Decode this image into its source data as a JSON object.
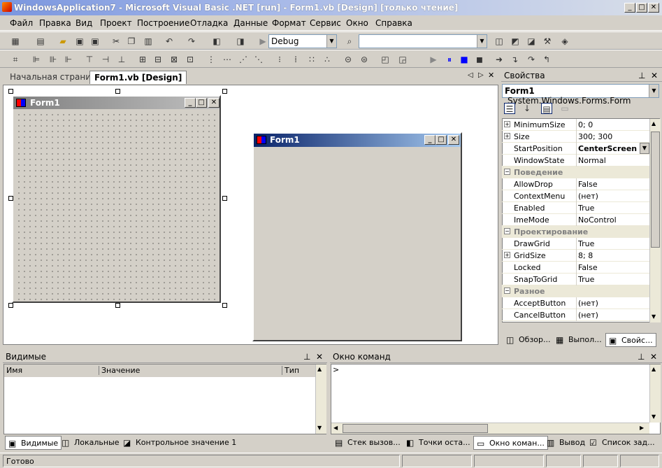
{
  "window": {
    "title": "WindowsApplication7 - Microsoft Visual Basic .NET [run] - Form1.vb [Design] [только чтение]"
  },
  "menu": [
    "Файл",
    "Правка",
    "Вид",
    "Проект",
    "Построение",
    "Отладка",
    "Данные",
    "Формат",
    "Сервис",
    "Окно",
    "Справка"
  ],
  "toolbar": {
    "config": "Debug",
    "platform": ""
  },
  "doc_tabs": [
    {
      "label": "Начальная страница"
    },
    {
      "label": "Form1.vb [Design]"
    }
  ],
  "design_form": {
    "caption": "Form1"
  },
  "run_form": {
    "caption": "Form1"
  },
  "properties": {
    "title": "Свойства",
    "object_name": "Form1",
    "object_type": "System.Windows.Forms.Form",
    "rows": [
      {
        "name": "MinimumSize",
        "value": "0; 0",
        "expand": true
      },
      {
        "name": "Size",
        "value": "300; 300",
        "expand": true
      },
      {
        "name": "StartPosition",
        "value": "CenterScreen",
        "selected": true
      },
      {
        "name": "WindowState",
        "value": "Normal"
      },
      {
        "category": "Поведение"
      },
      {
        "name": "AllowDrop",
        "value": "False"
      },
      {
        "name": "ContextMenu",
        "value": "(нет)"
      },
      {
        "name": "Enabled",
        "value": "True"
      },
      {
        "name": "ImeMode",
        "value": "NoControl"
      },
      {
        "category": "Проектирование"
      },
      {
        "name": "DrawGrid",
        "value": "True"
      },
      {
        "name": "GridSize",
        "value": "8; 8",
        "expand": true
      },
      {
        "name": "Locked",
        "value": "False"
      },
      {
        "name": "SnapToGrid",
        "value": "True"
      },
      {
        "category": "Разное"
      },
      {
        "name": "AcceptButton",
        "value": "(нет)"
      },
      {
        "name": "CancelButton",
        "value": "(нет)"
      }
    ],
    "bottom_tabs": [
      "Обзор...",
      "Выпол...",
      "Свойс..."
    ]
  },
  "autos": {
    "title": "Видимые",
    "columns": [
      "Имя",
      "Значение",
      "Тип"
    ],
    "tabs": [
      "Видимые",
      "Локальные",
      "Контрольное значение 1"
    ]
  },
  "command": {
    "title": "Окно команд",
    "prompt": ">",
    "tabs": [
      "Стек вызов...",
      "Точки оста...",
      "Окно коман...",
      "Вывод",
      "Список зад..."
    ]
  },
  "status": {
    "text": "Готово"
  }
}
